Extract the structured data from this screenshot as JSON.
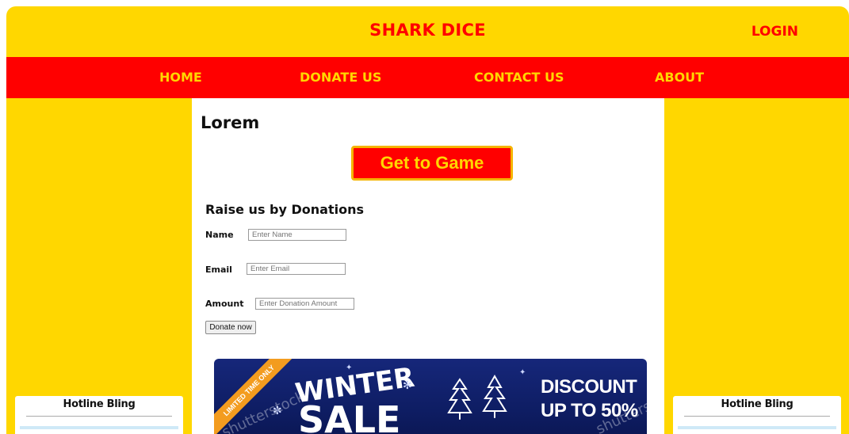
{
  "header": {
    "title": "SHARK DICE",
    "login_label": "LOGIN"
  },
  "nav": {
    "items": [
      {
        "label": "HOME"
      },
      {
        "label": "DONATE US"
      },
      {
        "label": "CONTACT US"
      },
      {
        "label": "ABOUT"
      }
    ]
  },
  "content": {
    "title": "Lorem",
    "game_button_label": "Get to Game",
    "form": {
      "title": "Raise us by Donations",
      "name_label": "Name",
      "name_placeholder": "Enter Name",
      "email_label": "Email",
      "email_placeholder": "Enter Email",
      "amount_label": "Amount",
      "amount_placeholder": "Enter Donation Amount",
      "submit_label": "Donate now"
    },
    "banner": {
      "ribbon": "LIMITED TIME ONLY",
      "line1": "WINTER",
      "line2": "SALE",
      "discount_line1": "DISCOUNT",
      "discount_line2": "UP TO 50%",
      "watermark": "shutterstock"
    }
  },
  "left_sidebar": {
    "card_title": "Hotline Bling"
  },
  "right_sidebar": {
    "card_title": "Hotline Bling"
  },
  "colors": {
    "background": "#ffd700",
    "nav_bar": "#ff0000",
    "accent_text": "#ff0000",
    "nav_text": "#ffd700",
    "banner_bg": "#16277a",
    "ribbon": "#f39c1f"
  },
  "icons": {
    "banner_decoration": "christmas-tree-icon",
    "snowflake": "snowflake-icon"
  }
}
